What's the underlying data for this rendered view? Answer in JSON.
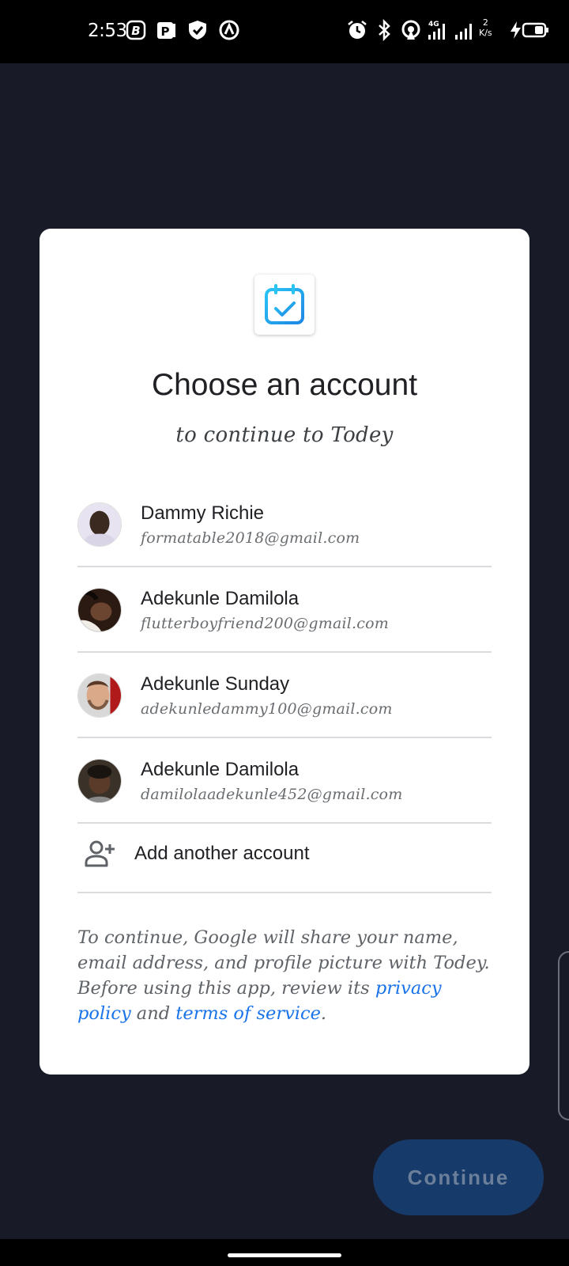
{
  "status_bar": {
    "time": "2:53",
    "net_speed_value": "2",
    "net_speed_unit": "K/s",
    "icons": [
      "notification-b-icon",
      "parking-icon",
      "shield-icon",
      "vpn-icon",
      "alarm-icon",
      "bluetooth-icon",
      "hotspot-icon",
      "signal-4g-icon",
      "signal-icon",
      "charging-icon",
      "battery-icon"
    ]
  },
  "dialog": {
    "app_icon": "calendar-check-icon",
    "title": "Choose an account",
    "subtitle": "to continue to Todey",
    "accounts": [
      {
        "name": "Dammy Richie",
        "email": "formatable2018@gmail.com"
      },
      {
        "name": "Adekunle Damilola",
        "email": "flutterboyfriend200@gmail.com"
      },
      {
        "name": "Adekunle Sunday",
        "email": "adekunledammy100@gmail.com"
      },
      {
        "name": "Adekunle Damilola",
        "email": "damilolaadekunle452@gmail.com"
      }
    ],
    "add_account_label": "Add another account",
    "footer": {
      "text_before": "To continue, Google will share your name, email address, and profile picture with Todey. Before using this app, review its ",
      "privacy_link": "privacy policy",
      "and": " and ",
      "terms_link": "terms of service",
      "end": "."
    }
  },
  "continue_button": {
    "label": "Continue"
  },
  "colors": {
    "accent": "#1a73e8",
    "background": "#181a28",
    "button": "#163a69"
  }
}
